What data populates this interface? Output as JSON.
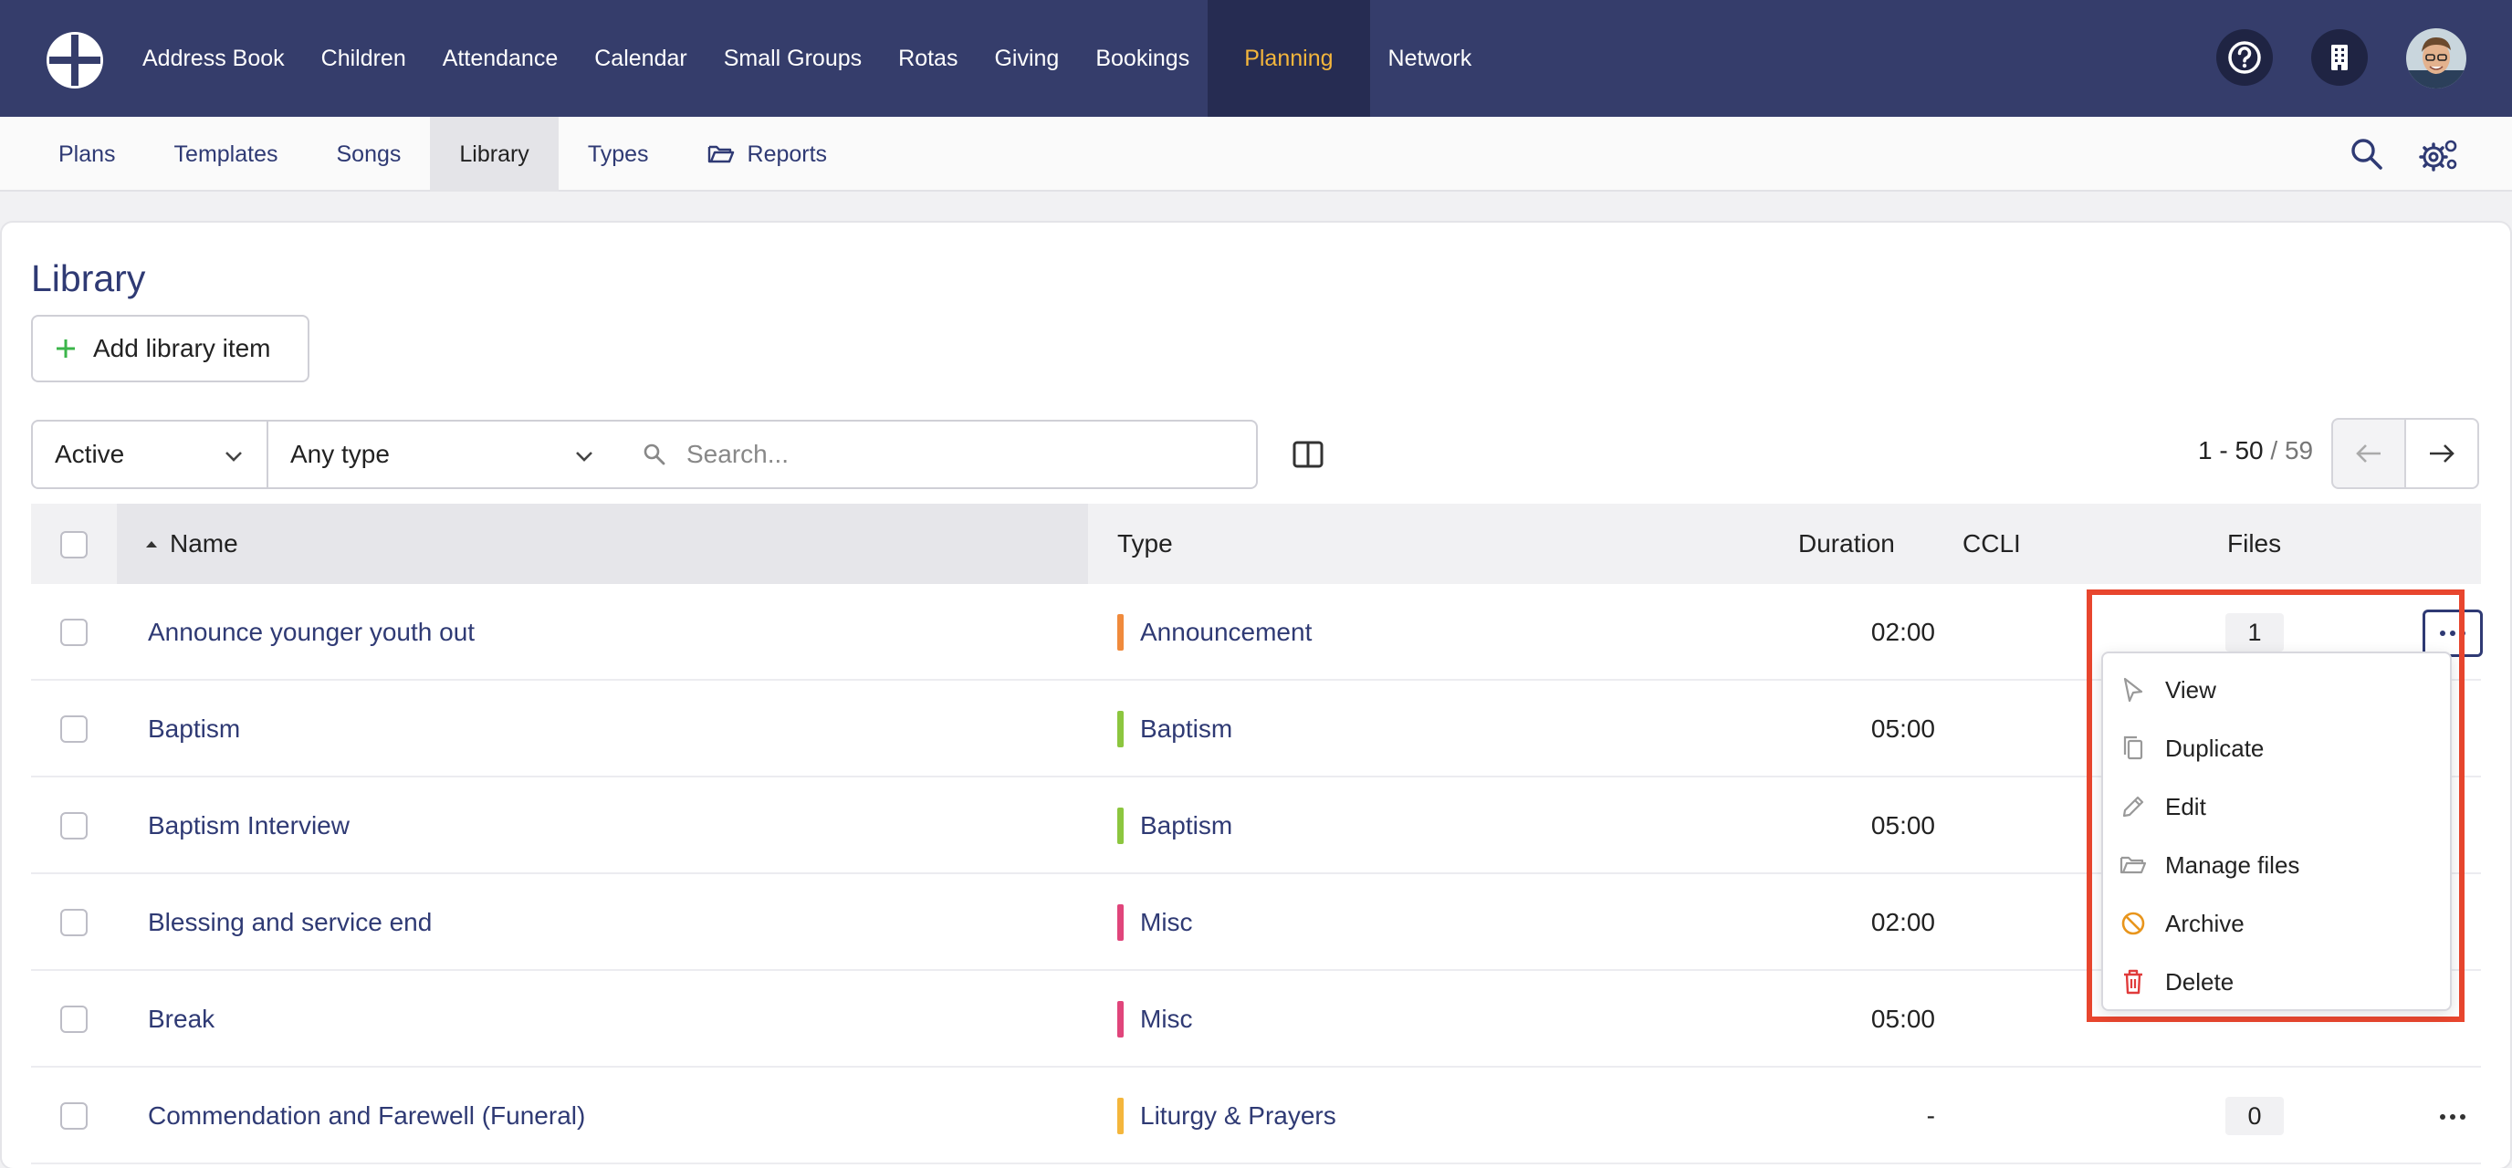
{
  "topnav": {
    "items": [
      "Address Book",
      "Children",
      "Attendance",
      "Calendar",
      "Small Groups",
      "Rotas",
      "Giving",
      "Bookings",
      "Planning",
      "Network"
    ],
    "active": "Planning"
  },
  "subnav": {
    "items": [
      "Plans",
      "Templates",
      "Songs",
      "Library",
      "Types",
      "Reports"
    ],
    "active": "Library"
  },
  "page": {
    "title": "Library",
    "add_label": "Add library item"
  },
  "filters": {
    "status": "Active",
    "type": "Any type",
    "search_placeholder": "Search..."
  },
  "pager": {
    "range": "1 - 50",
    "total": "/ 59"
  },
  "table": {
    "headers": {
      "name": "Name",
      "type": "Type",
      "duration": "Duration",
      "ccli": "CCLI",
      "files": "Files"
    },
    "rows": [
      {
        "name": "Announce younger youth out",
        "type": "Announcement",
        "type_color": "#f08a3c",
        "duration": "02:00",
        "files": "1"
      },
      {
        "name": "Baptism",
        "type": "Baptism",
        "type_color": "#8cc63f",
        "duration": "05:00",
        "files": ""
      },
      {
        "name": "Baptism Interview",
        "type": "Baptism",
        "type_color": "#8cc63f",
        "duration": "05:00",
        "files": ""
      },
      {
        "name": "Blessing and service end",
        "type": "Misc",
        "type_color": "#e0457b",
        "duration": "02:00",
        "files": ""
      },
      {
        "name": "Break",
        "type": "Misc",
        "type_color": "#e0457b",
        "duration": "05:00",
        "files": ""
      },
      {
        "name": "Commendation and Farewell (Funeral)",
        "type": "Liturgy & Prayers",
        "type_color": "#f4b63c",
        "duration": "-",
        "files": "0"
      }
    ]
  },
  "menu": {
    "items": [
      {
        "label": "View",
        "icon": "cursor-icon"
      },
      {
        "label": "Duplicate",
        "icon": "copy-icon"
      },
      {
        "label": "Edit",
        "icon": "pencil-icon"
      },
      {
        "label": "Manage files",
        "icon": "folder-icon"
      },
      {
        "label": "Archive",
        "icon": "archive-ban-icon"
      },
      {
        "label": "Delete",
        "icon": "trash-icon"
      }
    ]
  },
  "colors": {
    "nav_bg": "#353d6b",
    "nav_active_bg": "#262c52",
    "nav_active_text": "#f4b63c",
    "link": "#2f3a74",
    "highlight": "#e8462e",
    "archive": "#e8951c",
    "delete": "#e03b3b",
    "add_icon": "#3bb54a"
  }
}
